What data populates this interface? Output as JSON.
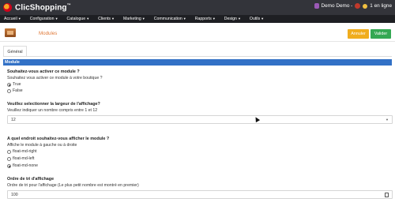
{
  "app": {
    "name": "ClicShopping",
    "trademark": "™"
  },
  "topbar": {
    "user": "Demo Demo -",
    "online": "1 en ligne"
  },
  "menu": [
    {
      "label": "Accueil"
    },
    {
      "label": "Configuration"
    },
    {
      "label": "Catalogue"
    },
    {
      "label": "Clients"
    },
    {
      "label": "Marketing"
    },
    {
      "label": "Communication"
    },
    {
      "label": "Rapports"
    },
    {
      "label": "Design"
    },
    {
      "label": "Outils"
    }
  ],
  "header": {
    "title": "Modules",
    "cancel_label": "Annuler",
    "validate_label": "Valider"
  },
  "tabs": [
    {
      "label": "Général"
    }
  ],
  "panel": {
    "title": "Module",
    "q1": {
      "title": "Souhaitez-vous activer ce module ?",
      "hint": "Souhaitez vous activer ce module à votre boutique ?",
      "options": [
        "True",
        "False"
      ],
      "selected": "True"
    },
    "q2": {
      "title": "Veuillez selectionner la largeur de l'affichage?",
      "hint": "Veuillez indiquer un nombre compris entre 1 et 12",
      "value": "12"
    },
    "q3": {
      "title": "A quel endroit souhaitez-vous afficher le module ?",
      "hint": "Affiche le module à gauche ou à droite",
      "options": [
        "float-md-right",
        "float-md-left",
        "float-md-none"
      ],
      "selected": "float-md-none"
    },
    "q4": {
      "title": "Ordre de tri d'affichage",
      "hint": "Ordre de tri pour l'affichage (Le plus petit nombre est montré en premier)",
      "value": "100"
    }
  },
  "colors": {
    "accent": "#3271c6",
    "cancel": "#f0ad1e",
    "validate": "#34a853",
    "title": "#e07a3a",
    "topbar": "#33343a",
    "menubar": "#1e1f23"
  },
  "icons": {
    "logo": "clicshopping-logo-icon",
    "user": "user-icon",
    "power": "power-icon",
    "status": "online-dot-icon",
    "module": "module-icon",
    "select": "chevron-down-icon",
    "calculator": "calculator-icon",
    "pointer": "mouse-cursor-icon"
  }
}
